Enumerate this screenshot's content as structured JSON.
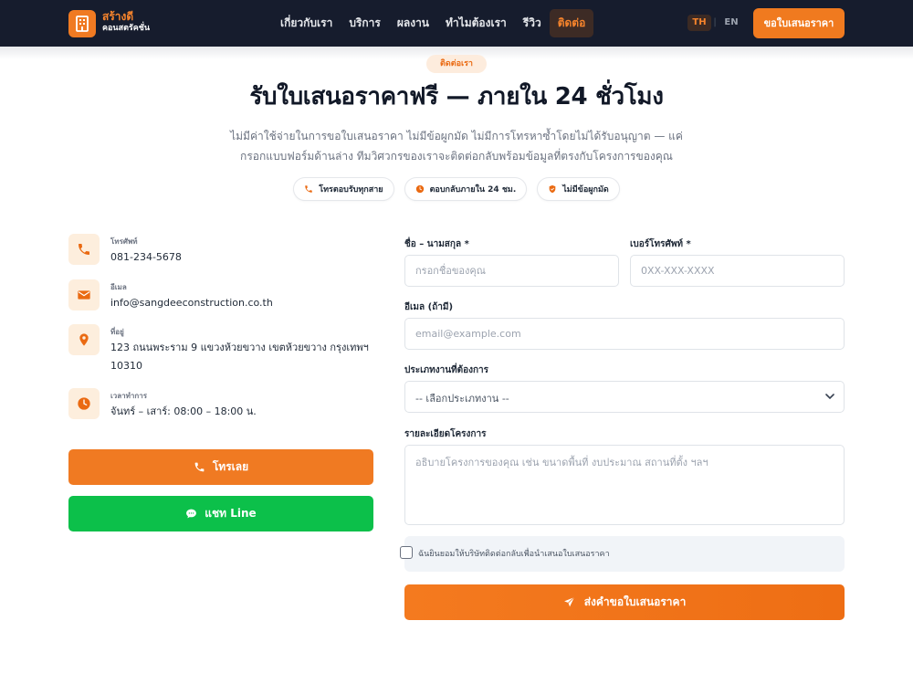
{
  "brand": {
    "name": "สร้างดี",
    "tagline": "คอนสตรัคชั่น",
    "icon": "building-icon"
  },
  "nav": {
    "items": [
      {
        "label": "เกี่ยวกับเรา",
        "active": false
      },
      {
        "label": "บริการ",
        "active": false
      },
      {
        "label": "ผลงาน",
        "active": false
      },
      {
        "label": "ทำไมต้องเรา",
        "active": false
      },
      {
        "label": "รีวิว",
        "active": false
      },
      {
        "label": "ติดต่อ",
        "active": true
      }
    ],
    "lang_th": "TH",
    "lang_sep": "|",
    "lang_en": "EN",
    "cta": "ขอใบเสนอราคา"
  },
  "hero": {
    "eyebrow": "ติดต่อเรา",
    "title": "รับใบเสนอราคาฟรี — ภายใน 24 ชั่วโมง",
    "subtitle": "ไม่มีค่าใช้จ่ายในการขอใบเสนอราคา ไม่มีข้อผูกมัด ไม่มีการโทรหาซ้ำโดยไม่ได้รับอนุญาต — แค่กรอกแบบฟอร์มด้านล่าง ทีมวิศวกรของเราจะติดต่อกลับพร้อมข้อมูลที่ตรงกับโครงการของคุณ",
    "pills": [
      {
        "label": "โทรตอบรับทุกสาย",
        "icon": "phone-icon"
      },
      {
        "label": "ตอบกลับภายใน 24 ชม.",
        "icon": "clock-icon"
      },
      {
        "label": "ไม่มีข้อผูกมัด",
        "icon": "shield-icon"
      }
    ]
  },
  "contact": {
    "phone": {
      "label": "โทรศัพท์",
      "value": "081-234-5678",
      "icon": "phone-icon"
    },
    "email": {
      "label": "อีเมล",
      "value": "info@sangdeeconstruction.co.th",
      "icon": "mail-icon"
    },
    "address": {
      "label": "ที่อยู่",
      "value": "123 ถนนพระราม 9 แขวงห้วยขวาง เขตห้วยขวาง กรุงเทพฯ 10310",
      "icon": "map-pin-icon"
    },
    "hours": {
      "label": "เวลาทำการ",
      "value": "จันทร์ – เสาร์: 08:00 – 18:00 น.",
      "icon": "clock-icon"
    },
    "call_button": "โทรเลย",
    "line_button": "แชท Line"
  },
  "form": {
    "name_label": "ชื่อ – นามสกุล *",
    "name_placeholder": "กรอกชื่อของคุณ",
    "phone_label": "เบอร์โทรศัพท์ *",
    "phone_placeholder": "0XX-XXX-XXXX",
    "email_label": "อีเมล (ถ้ามี)",
    "email_placeholder": "email@example.com",
    "type_label": "ประเภทงานที่ต้องการ",
    "type_selected": "-- เลือกประเภทงาน --",
    "details_label": "รายละเอียดโครงการ",
    "details_placeholder": "อธิบายโครงการของคุณ เช่น ขนาดพื้นที่ งบประมาณ สถานที่ตั้ง ฯลฯ",
    "consent_text": "ฉันยินยอมให้บริษัทติดต่อกลับเพื่อนำเสนอใบเสนอราคา",
    "consent_checked": false,
    "submit": "ส่งคำขอใบเสนอราคา"
  },
  "colors": {
    "accent": "#f07a22",
    "nav_bg": "#161c2d",
    "line_green": "#0cc04a"
  }
}
